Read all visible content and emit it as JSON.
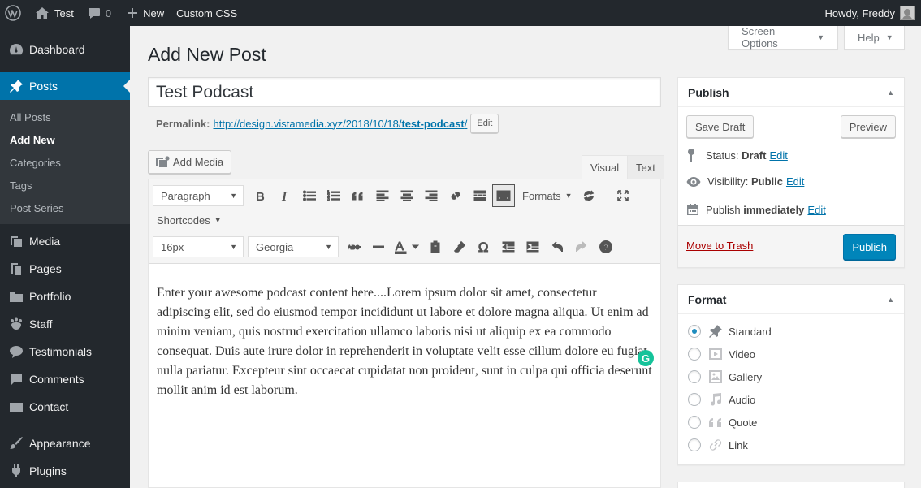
{
  "admin_bar": {
    "site_name": "Test",
    "comments_count": "0",
    "new_label": "New",
    "custom_css_label": "Custom CSS",
    "howdy": "Howdy, Freddy"
  },
  "sidebar": {
    "dashboard": "Dashboard",
    "posts": "Posts",
    "posts_submenu": [
      "All Posts",
      "Add New",
      "Categories",
      "Tags",
      "Post Series"
    ],
    "media": "Media",
    "pages": "Pages",
    "portfolio": "Portfolio",
    "staff": "Staff",
    "testimonials": "Testimonials",
    "comments": "Comments",
    "contact": "Contact",
    "appearance": "Appearance",
    "plugins": "Plugins"
  },
  "header": {
    "screen_options": "Screen Options",
    "help": "Help",
    "page_title": "Add New Post"
  },
  "editor": {
    "title_value": "Test Podcast",
    "permalink_label": "Permalink:",
    "permalink_base": "http://design.vistamedia.xyz/2018/10/18/",
    "permalink_slug": "test-podcast",
    "permalink_trailing": "/",
    "permalink_edit": "Edit",
    "add_media": "Add Media",
    "tab_visual": "Visual",
    "tab_text": "Text",
    "format_select": "Paragraph",
    "formats_menu": "Formats",
    "shortcodes_menu": "Shortcodes",
    "font_size": "16px",
    "font_family": "Georgia",
    "content": "Enter your awesome podcast content here....Lorem ipsum dolor sit amet, consectetur adipiscing elit, sed do eiusmod tempor incididunt ut labore et dolore magna aliqua. Ut enim ad minim veniam, quis nostrud exercitation ullamco laboris nisi ut aliquip ex ea commodo consequat. Duis aute irure dolor in reprehenderit in voluptate velit esse cillum dolore eu fugiat nulla pariatur. Excepteur sint occaecat cupidatat non proident, sunt in culpa qui officia deserunt mollit anim id est laborum.",
    "grammarly": "G"
  },
  "publish": {
    "title": "Publish",
    "save_draft": "Save Draft",
    "preview": "Preview",
    "status_label": "Status:",
    "status_value": "Draft",
    "visibility_label": "Visibility:",
    "visibility_value": "Public",
    "publish_label": "Publish",
    "publish_value": "immediately",
    "edit": "Edit",
    "move_to_trash": "Move to Trash",
    "publish_button": "Publish"
  },
  "format": {
    "title": "Format",
    "options": [
      "Standard",
      "Video",
      "Gallery",
      "Audio",
      "Quote",
      "Link"
    ],
    "selected": "Standard"
  },
  "colors": {
    "admin_dark": "#23282d",
    "accent_blue": "#0073aa",
    "publish_button": "#0085ba",
    "trash_red": "#a00"
  }
}
